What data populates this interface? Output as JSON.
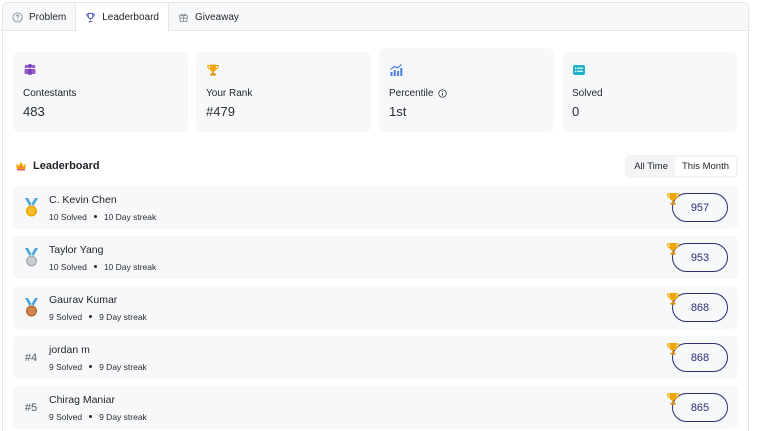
{
  "tabs": [
    {
      "label": "Problem",
      "icon": "help-circle-icon"
    },
    {
      "label": "Leaderboard",
      "icon": "trophy-icon"
    },
    {
      "label": "Giveaway",
      "icon": "gift-icon"
    }
  ],
  "stats": [
    {
      "label": "Contestants",
      "value": "483",
      "icon": "users-icon"
    },
    {
      "label": "Your Rank",
      "value": "#479",
      "icon": "trophy-icon"
    },
    {
      "label": "Percentile",
      "value": "1st",
      "icon": "chart-up-icon"
    },
    {
      "label": "Solved",
      "value": "0",
      "icon": "list-icon"
    }
  ],
  "leaderboard": {
    "title": "Leaderboard",
    "filter": {
      "all_time": "All Time",
      "this_month": "This Month",
      "selected": "This Month"
    },
    "entries": [
      {
        "rank_label": "",
        "medal": "gold",
        "medal_number": "1",
        "name": "C. Kevin Chen",
        "solved": "10 Solved",
        "streak": "10 Day streak",
        "score": "957"
      },
      {
        "rank_label": "",
        "medal": "silver",
        "medal_number": "2",
        "name": "Taylor Yang",
        "solved": "10 Solved",
        "streak": "10 Day streak",
        "score": "953"
      },
      {
        "rank_label": "",
        "medal": "bronze",
        "medal_number": "3",
        "name": "Gaurav Kumar",
        "solved": "9 Solved",
        "streak": "9 Day streak",
        "score": "868"
      },
      {
        "rank_label": "#4",
        "medal": "",
        "name": "jordan m",
        "solved": "9 Solved",
        "streak": "9 Day streak",
        "score": "868"
      },
      {
        "rank_label": "#5",
        "medal": "",
        "name": "Chirag Maniar",
        "solved": "9 Solved",
        "streak": "9 Day streak",
        "score": "865"
      }
    ]
  },
  "colors": {
    "accent_navy": "#2b2f73",
    "gold": "#f0a500",
    "silver": "#b8bcc2",
    "bronze": "#c8793b",
    "ribbon": "#4aa8d8"
  }
}
